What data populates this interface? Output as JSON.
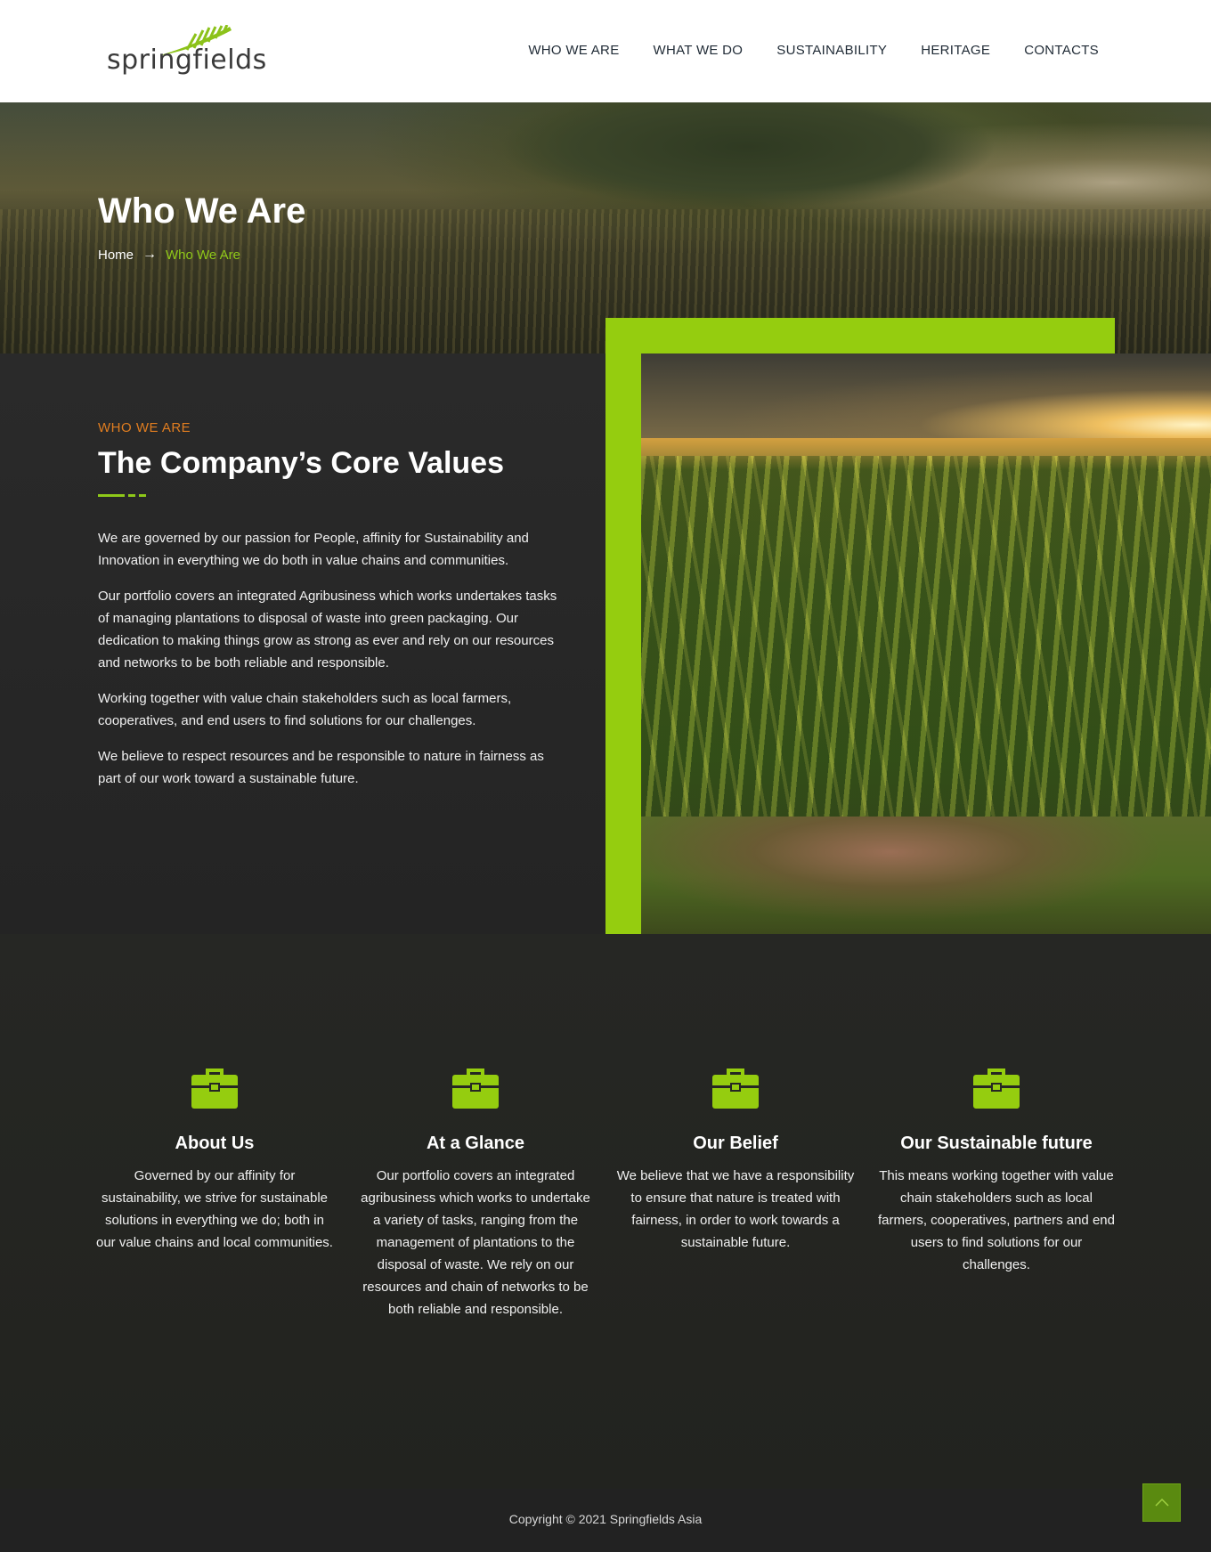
{
  "header": {
    "logo_text": "springfields",
    "nav": [
      {
        "label": "WHO WE ARE"
      },
      {
        "label": "WHAT WE DO"
      },
      {
        "label": "SUSTAINABILITY"
      },
      {
        "label": "HERITAGE"
      },
      {
        "label": "CONTACTS"
      }
    ]
  },
  "hero": {
    "title": "Who We Are",
    "breadcrumb": {
      "home": "Home",
      "separator": "→",
      "current": "Who We Are"
    }
  },
  "about": {
    "eyebrow": "WHO WE ARE",
    "title": "The Company’s Core Values",
    "paragraphs": [
      "We are governed by our passion for People, affinity for Sustainability and Innovation in everything we do both in value chains and communities.",
      "Our portfolio covers an integrated Agribusiness which works undertakes tasks of managing plantations to disposal of waste into green packaging. Our dedication to making things grow as strong as ever and rely on our resources and networks to be both reliable and responsible.",
      "Working together with value chain stakeholders such as local farmers, cooperatives, and end users to find solutions for our challenges.",
      "We believe to respect resources and be responsible to nature in fairness as part of our work toward a sustainable future."
    ]
  },
  "features": [
    {
      "icon": "briefcase-icon",
      "title": "About Us",
      "text": "Governed by our affinity for sustainability, we strive for sustainable solutions in everything we do; both in our value chains and local communities."
    },
    {
      "icon": "briefcase-icon",
      "title": "At a Glance",
      "text": "Our portfolio covers an integrated agribusiness which works to undertake a variety of tasks, ranging from the management of plantations to the disposal of waste. We rely on our resources and chain of networks to be both reliable and responsible."
    },
    {
      "icon": "briefcase-icon",
      "title": "Our Belief",
      "text": "We believe that we have a responsibility to ensure that nature is treated with fairness, in order to work towards a sustainable future."
    },
    {
      "icon": "briefcase-icon",
      "title": "Our Sustainable future",
      "text": "This means working together with value chain stakeholders such as local farmers, cooperatives, partners and end users to find solutions for our challenges."
    }
  ],
  "footer": {
    "copyright": "Copyright © 2021 Springfields Asia",
    "to_top_icon": "chevron-up-icon"
  },
  "colors": {
    "accent_green": "#95cd0f",
    "eyebrow_orange": "#e07d20",
    "breadcrumb_green": "#8fc919"
  }
}
